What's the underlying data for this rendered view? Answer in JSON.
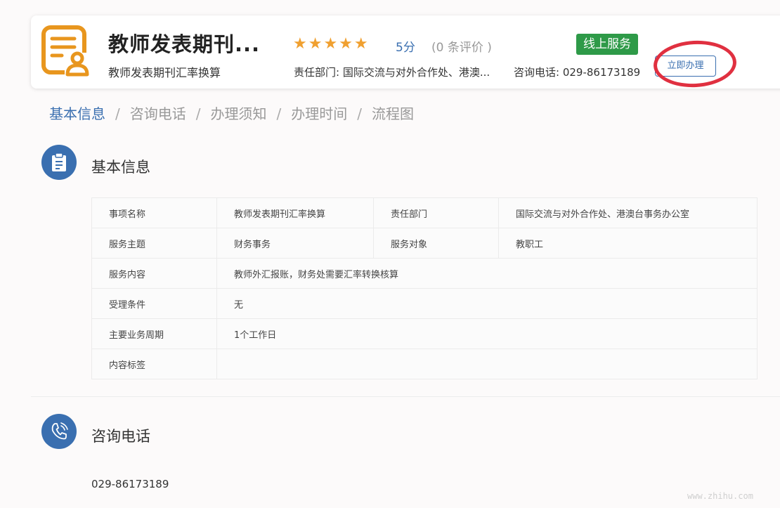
{
  "header": {
    "title": "教师发表期刊...",
    "subtitle": "教师发表期刊汇率换算",
    "rating": {
      "stars": "★★★★★",
      "score": "5分",
      "reviews": "(0 条评价 )"
    },
    "badge": "线上服务",
    "department": "责任部门: 国际交流与对外合作处、港澳...",
    "phone": "咨询电话: 029-86173189",
    "apply_button": "立即办理"
  },
  "tabs": [
    "基本信息",
    "咨询电话",
    "办理须知",
    "办理时间",
    "流程图"
  ],
  "tab_separator": "/",
  "sections": {
    "basic": {
      "title": "基本信息"
    },
    "contact": {
      "title": "咨询电话",
      "phone": "029-86173189"
    }
  },
  "info_table": {
    "item_name_label": "事项名称",
    "item_name": "教师发表期刊汇率换算",
    "dept_label": "责任部门",
    "dept": "国际交流与对外合作处、港澳台事务办公室",
    "topic_label": "服务主题",
    "topic": "财务事务",
    "target_label": "服务对象",
    "target": "教职工",
    "content_label": "服务内容",
    "content": "教师外汇报账，财务处需要汇率转换核算",
    "condition_label": "受理条件",
    "condition": "无",
    "period_label": "主要业务周期",
    "period": "1个工作日",
    "tags_label": "内容标签",
    "tags": ""
  },
  "colors": {
    "accent": "#3a6fb0",
    "badge": "#2e9a48",
    "star": "#f0a030",
    "annotation": "#e03040",
    "app_icon": "#e8961e"
  },
  "icons": {
    "app": "document-user-icon",
    "basic": "clipboard-icon",
    "contact": "phone-icon"
  },
  "watermark": "www.zhihu.com"
}
